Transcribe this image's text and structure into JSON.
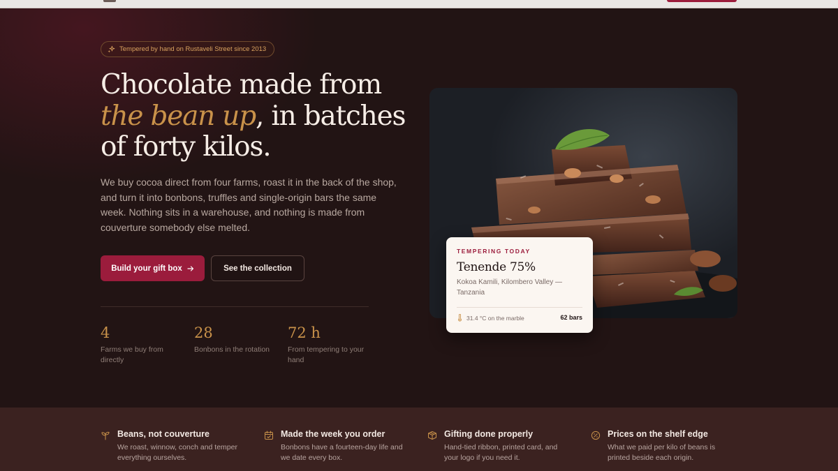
{
  "badge": {
    "icon": "sparkle-icon",
    "text": "Tempered by hand on Rustaveli Street since 2013"
  },
  "headline": {
    "line1": "Chocolate made from",
    "accent": "the bean up",
    "rest": ", in batches",
    "line3": "of forty kilos."
  },
  "intro": "We buy cocoa direct from four farms, roast it in the back of the shop, and turn it into bonbons, truffles and single-origin bars the same week. Nothing sits in a warehouse, and nothing is made from couverture somebody else melted.",
  "actions": {
    "primary": "Build your gift box",
    "primary_icon": "arrow-right-icon",
    "secondary": "See the collection"
  },
  "stats": [
    {
      "value": "4",
      "label": "Farms we buy from directly"
    },
    {
      "value": "28",
      "label": "Bonbons in the rotation"
    },
    {
      "value": "72 h",
      "label": "From tempering to your hand"
    }
  ],
  "tempering_card": {
    "eyebrow": "TEMPERING TODAY",
    "title": "Tenende 75%",
    "origin": "Kokoa Kamili, Kilombero Valley — Tanzania",
    "temperature_icon": "thermometer-icon",
    "temperature": "31.4 °C on the marble",
    "count": "62 bars"
  },
  "features": [
    {
      "icon": "sprout-icon",
      "title": "Beans, not couverture",
      "desc": "We roast, winnow, conch and temper everything ourselves."
    },
    {
      "icon": "calendar-icon",
      "title": "Made the week you order",
      "desc": "Bonbons have a fourteen-day life and we date every box."
    },
    {
      "icon": "gift-box-icon",
      "title": "Gifting done properly",
      "desc": "Hand-tied ribbon, printed card, and your logo if you need it."
    },
    {
      "icon": "percent-badge-icon",
      "title": "Prices on the shelf edge",
      "desc": "What we paid per kilo of beans is printed beside each origin."
    }
  ],
  "colors": {
    "accent_gold": "#c9924a",
    "brand_crimson": "#9b1c3c",
    "background": "#221414",
    "feature_band": "#3b2220"
  }
}
